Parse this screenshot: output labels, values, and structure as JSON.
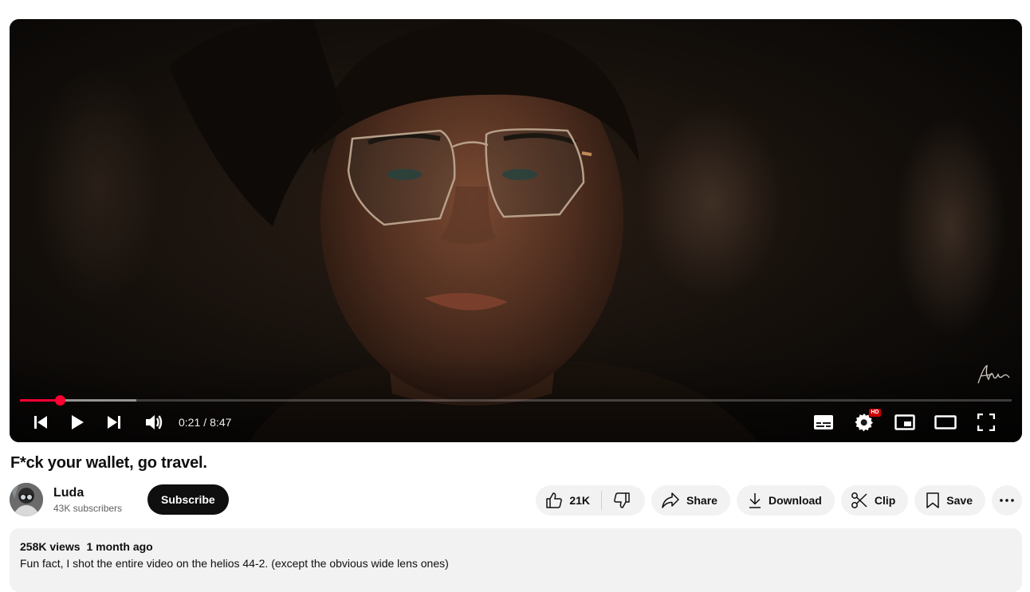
{
  "player": {
    "current_time": "0:21",
    "time_separator": "/",
    "duration": "8:47",
    "played_fraction": 0.04,
    "buffered_fraction": 0.117,
    "hd_badge": "HD",
    "accent_color": "#ff0033"
  },
  "video": {
    "title": "F*ck your wallet, go travel."
  },
  "channel": {
    "name": "Luda",
    "subscribers": "43K subscribers",
    "subscribe_label": "Subscribe"
  },
  "actions": {
    "like_count": "21K",
    "share_label": "Share",
    "download_label": "Download",
    "clip_label": "Clip",
    "save_label": "Save"
  },
  "description": {
    "views": "258K views",
    "date": "1 month ago",
    "text": "Fun fact, I shot the entire video on the helios 44-2. (except the obvious wide lens ones)"
  },
  "icons": [
    "previous-icon",
    "play-icon",
    "next-icon",
    "volume-icon",
    "subtitles-icon",
    "settings-icon",
    "miniplayer-icon",
    "theater-icon",
    "fullscreen-icon",
    "like-icon",
    "dislike-icon",
    "share-icon",
    "download-icon",
    "clip-icon",
    "save-icon",
    "more-icon"
  ]
}
